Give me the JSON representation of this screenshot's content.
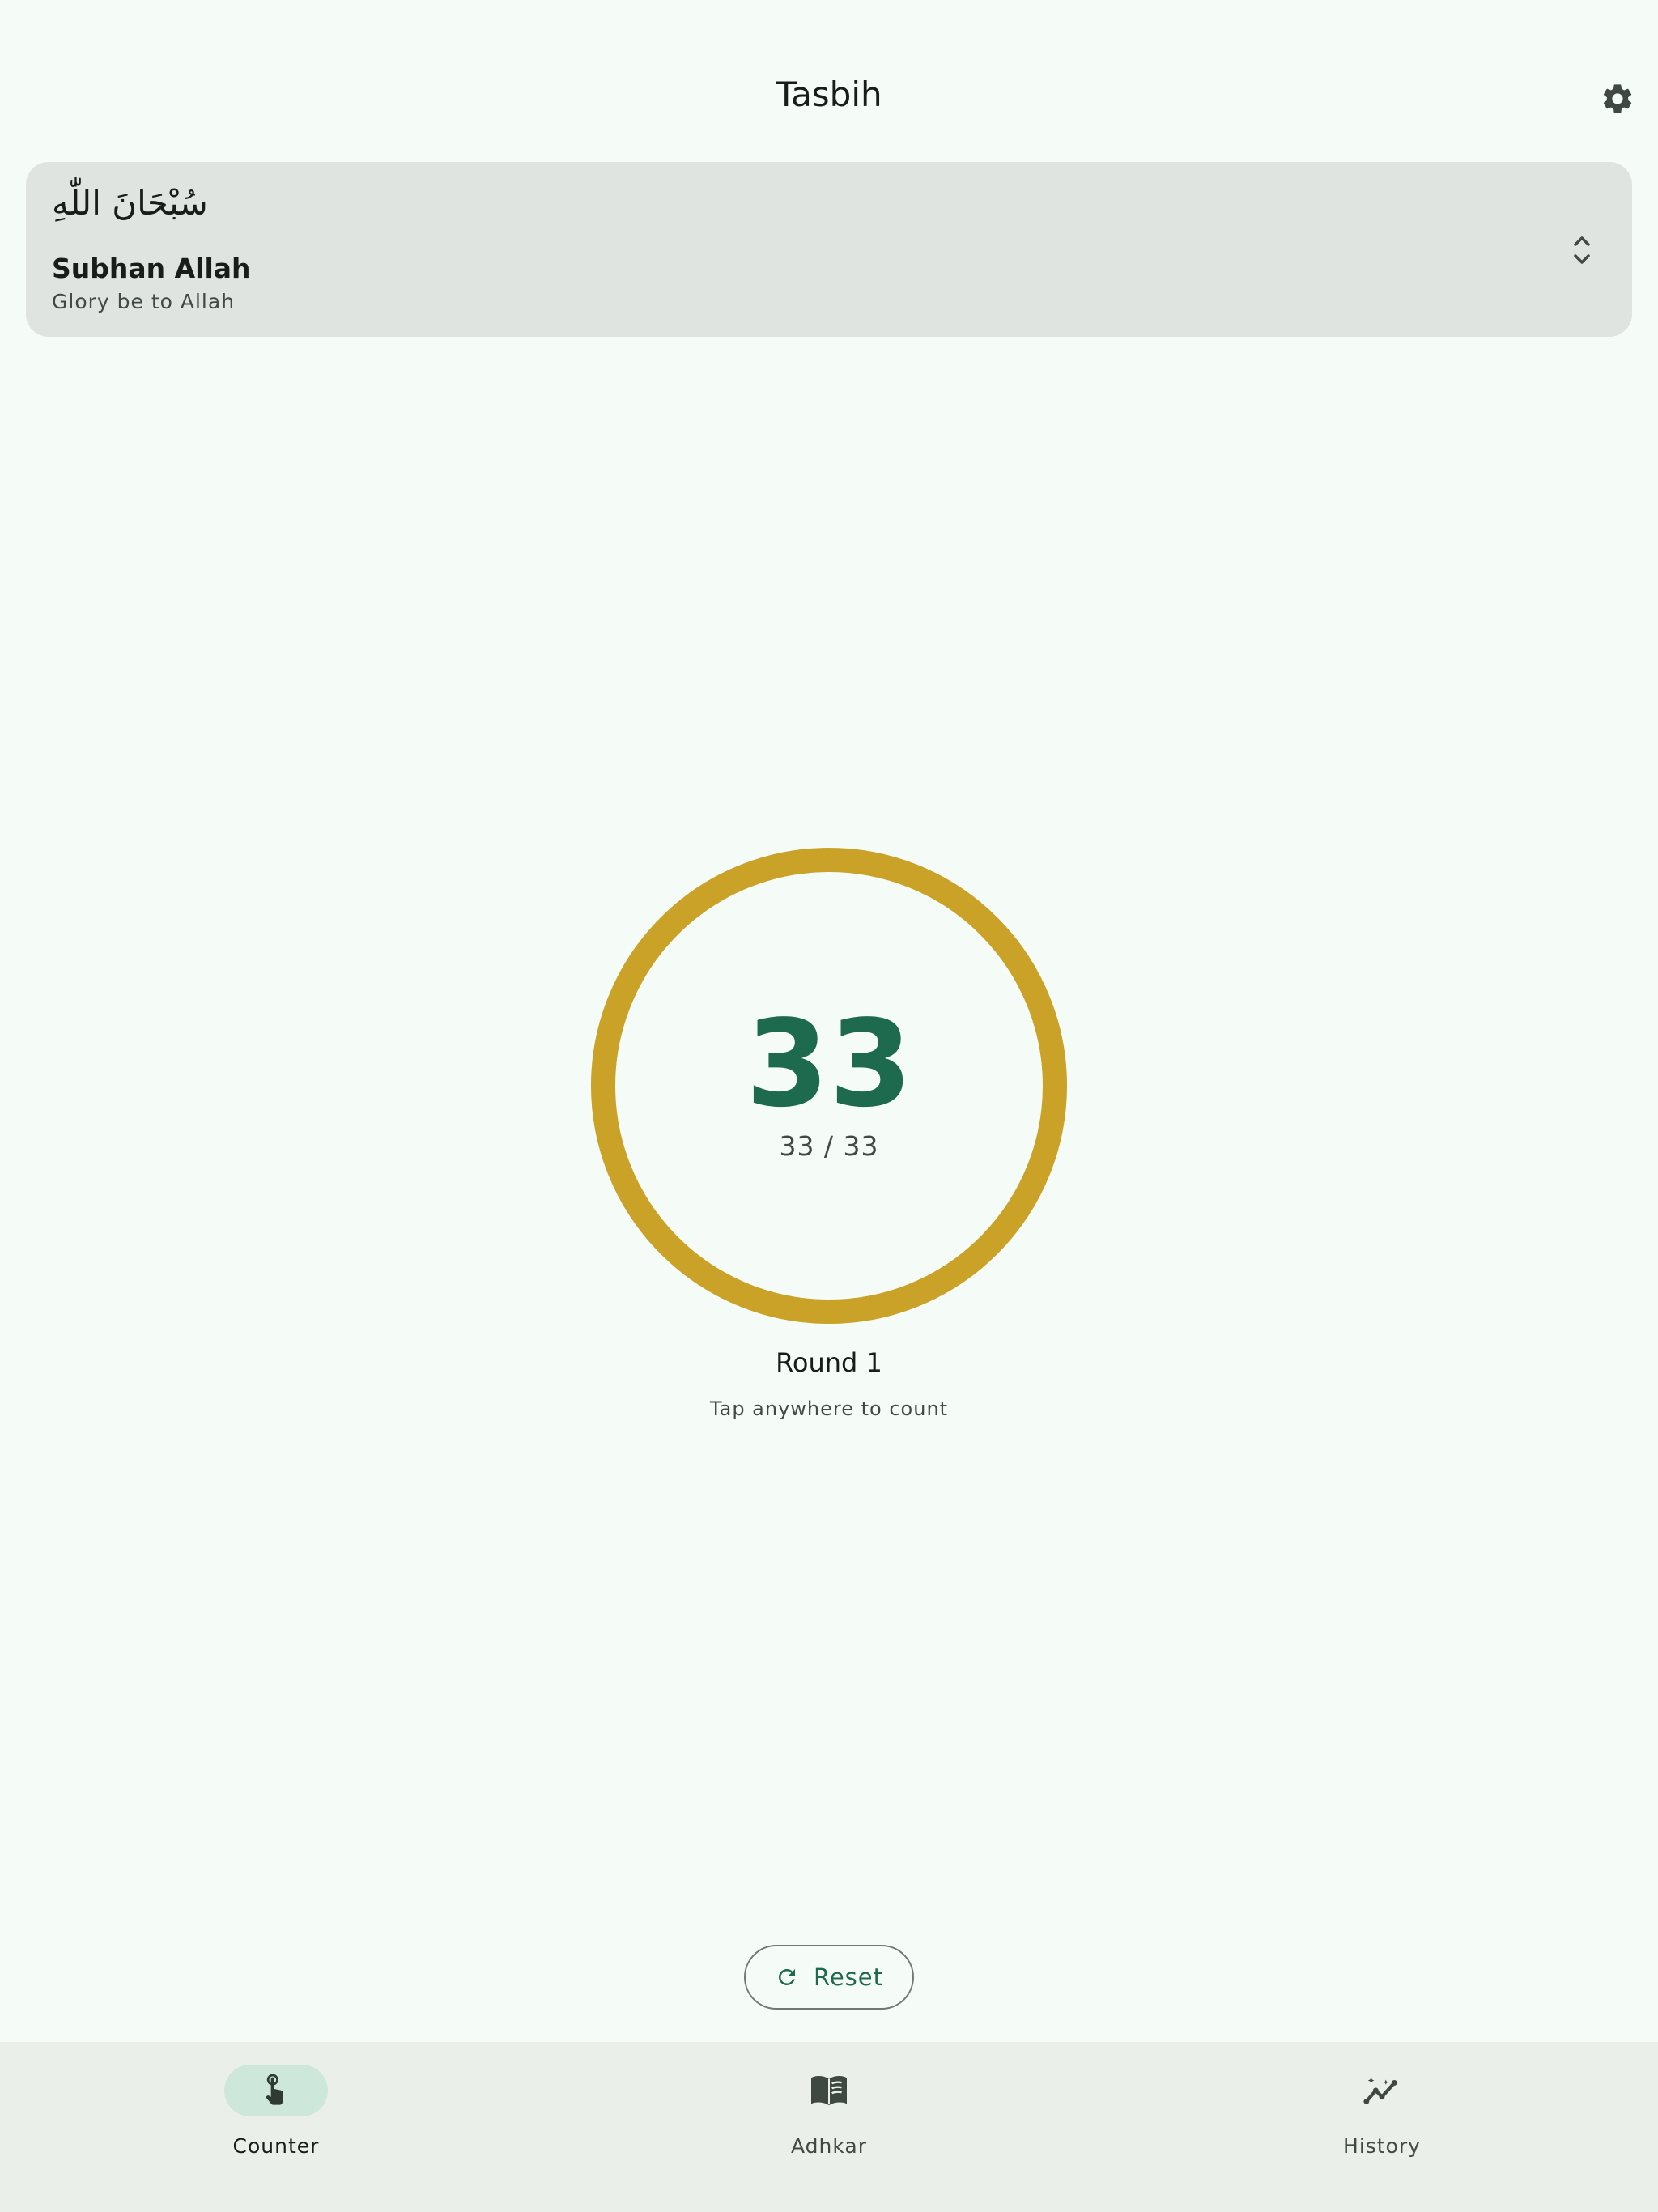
{
  "header": {
    "title": "Tasbih",
    "settings_icon": "gear-icon"
  },
  "dhikr": {
    "arabic": "سُبْحَانَ اللّٰهِ",
    "transliteration": "Subhan Allah",
    "meaning": "Glory be to Allah",
    "selector_icon": "unfold-chevrons-icon"
  },
  "counter": {
    "count": "33",
    "progress_text": "33 / 33",
    "progress_fraction": 1.0,
    "round_label": "Round 1",
    "hint": "Tap anywhere to count"
  },
  "reset": {
    "label": "Reset",
    "icon": "refresh-icon"
  },
  "nav": {
    "items": [
      {
        "label": "Counter",
        "icon": "tap-hand-icon",
        "active": true
      },
      {
        "label": "Adhkar",
        "icon": "book-icon",
        "active": false
      },
      {
        "label": "History",
        "icon": "trend-sparkle-icon",
        "active": false
      }
    ]
  },
  "colors": {
    "background": "#f5fbf6",
    "primary": "#1d6a4f",
    "ring": "#c9a227",
    "card": "#dfe4e0",
    "nav_background": "#eaefe9",
    "nav_active_pill": "#cde8da"
  }
}
